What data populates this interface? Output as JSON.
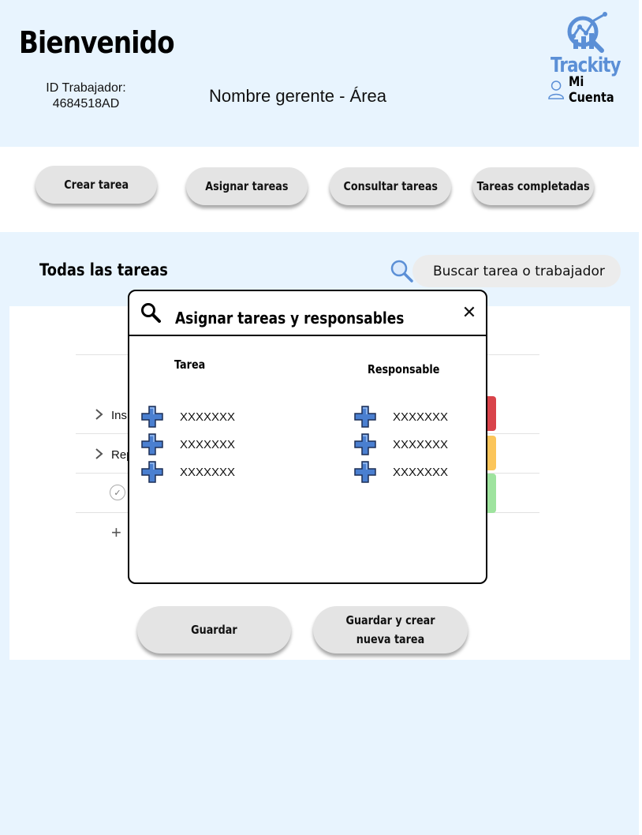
{
  "header": {
    "welcome": "Bienvenido",
    "worker_id_label": "ID Trabajador:",
    "worker_id_value": "4684518AD",
    "manager_area": "Nombre gerente - Área",
    "logo_text": "Trackity",
    "account_label": "Mi Cuenta"
  },
  "toolbar": {
    "create_task": "Crear tarea",
    "assign_tasks": "Asignar tareas",
    "view_tasks": "Consultar tareas",
    "completed_tasks": "Tareas completadas"
  },
  "section": {
    "title": "Todas las tareas",
    "search_placeholder": "Buscar tarea o trabajador"
  },
  "task_rows": [
    {
      "label": "Ins",
      "status_color": "#d9434a"
    },
    {
      "label": "Rep",
      "status_color": "#fbc55a"
    },
    {
      "label": "",
      "status_color": "#9ee39e"
    }
  ],
  "add_row_symbol": "+",
  "modal": {
    "title": "Asignar tareas y responsables",
    "close_symbol": "✕",
    "col_task": "Tarea",
    "col_responsible": "Responsable",
    "tasks": [
      "XXXXXXX",
      "XXXXXXX",
      "XXXXXXX"
    ],
    "responsibles": [
      "XXXXXXX",
      "XXXXXXX",
      "XXXXXXX"
    ]
  },
  "actions": {
    "save": "Guardar",
    "save_and_new": "Guardar y crear nueva tarea"
  },
  "colors": {
    "app_background": "#e8f4fe",
    "brand_blue": "#5b8fd6",
    "pill_gray": "#e4e4e4",
    "plus_blue": "#4a7fd0"
  },
  "icons": {
    "logo": "magnifier-chart-logo-icon",
    "account": "user-outline-icon",
    "search": "magnifier-icon",
    "modal_search": "search-icon",
    "close": "close-icon",
    "plus": "plus-icon",
    "chevron": "chevron-right-icon",
    "check": "check-circle-icon"
  }
}
